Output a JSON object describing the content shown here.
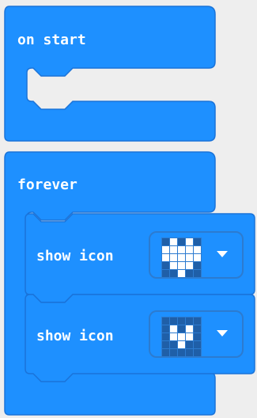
{
  "workspace": {
    "blocks": {
      "on_start": {
        "label": "on start"
      },
      "forever": {
        "label": "forever",
        "statements": [
          {
            "label": "show icon",
            "icon": "heart",
            "leds": [
              0,
              1,
              0,
              1,
              0,
              1,
              1,
              1,
              1,
              1,
              1,
              1,
              1,
              1,
              1,
              0,
              1,
              1,
              1,
              0,
              0,
              0,
              1,
              0,
              0
            ]
          },
          {
            "label": "show icon",
            "icon": "small-heart",
            "leds": [
              0,
              0,
              0,
              0,
              0,
              0,
              1,
              0,
              1,
              0,
              0,
              1,
              1,
              1,
              0,
              0,
              0,
              1,
              0,
              0,
              0,
              0,
              0,
              0,
              0
            ]
          }
        ]
      }
    }
  },
  "colors": {
    "block_blue": "#1e90ff",
    "block_border": "#1a73d9",
    "workspace_bg": "#eeeeee",
    "dropdown_border": "#2c7bd0",
    "led_off": "#1f5fa8",
    "led_on": "#ffffff"
  }
}
